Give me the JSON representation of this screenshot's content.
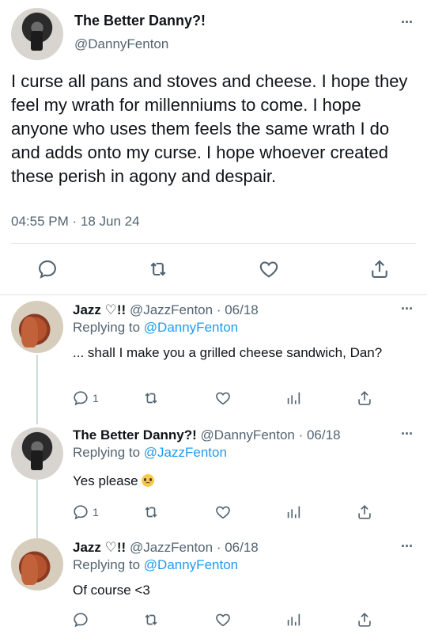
{
  "main_tweet": {
    "name": "The Better Danny?!",
    "handle": "@DannyFenton",
    "text": "I curse all pans and stoves and cheese. I hope they feel my wrath for millenniums to come. I hope anyone who uses them feels the same wrath I do and adds onto my curse. I hope whoever created these perish in agony and despair.",
    "timestamp": "04:55 PM · 18 Jun 24",
    "more_label": "···"
  },
  "replies": [
    {
      "name": "Jazz ♡!!",
      "handle": "@JazzFenton",
      "date": "· 06/18",
      "replying_prefix": "Replying to ",
      "replying_to": "@DannyFenton",
      "text": "... shall I make you a grilled cheese sandwich, Dan?",
      "reply_count": "1",
      "more_label": "···"
    },
    {
      "name": "The Better Danny?!",
      "handle": "@DannyFenton",
      "date": "· 06/18",
      "replying_prefix": "Replying to ",
      "replying_to": "@JazzFenton",
      "text": "Yes please",
      "emoji": "pleading-face",
      "reply_count": "1",
      "more_label": "···"
    },
    {
      "name": "Jazz ♡!!",
      "handle": "@JazzFenton",
      "date": "· 06/18",
      "replying_prefix": "Replying to ",
      "replying_to": "@DannyFenton",
      "text": "Of course <3",
      "reply_count": "",
      "more_label": "···"
    }
  ],
  "icons": {
    "reply": "reply-icon",
    "retweet": "retweet-icon",
    "like": "heart-icon",
    "views": "views-icon",
    "share": "share-icon"
  },
  "colors": {
    "link": "#1d9bf0",
    "muted": "#536471",
    "text": "#0f1419"
  }
}
